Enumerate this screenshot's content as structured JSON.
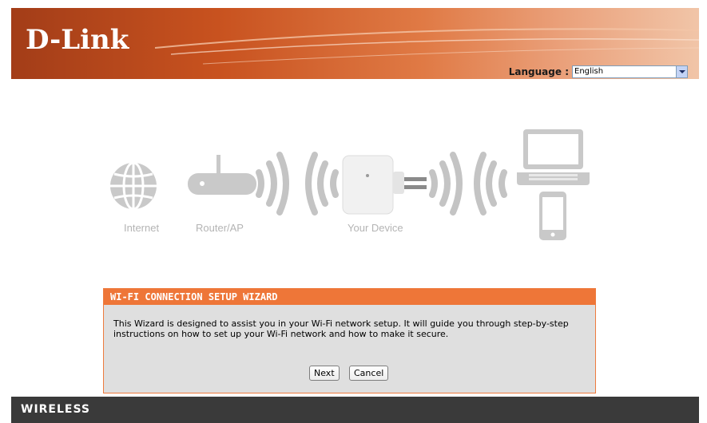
{
  "header": {
    "logo": "D-Link",
    "language_label": "Language :",
    "language_value": "English"
  },
  "diagram": {
    "labels": [
      "Internet",
      "Router/AP",
      "Your Device"
    ]
  },
  "wizard": {
    "title": "WI-FI CONNECTION SETUP WIZARD",
    "description_line1": "This Wizard is designed to assist you in your Wi-Fi network setup. It will guide you through step-by-step",
    "description_line2": "instructions on how to set up your Wi-Fi network and how to make it secure.",
    "next_label": "Next",
    "cancel_label": "Cancel"
  },
  "footer": {
    "label": "WIRELESS"
  }
}
